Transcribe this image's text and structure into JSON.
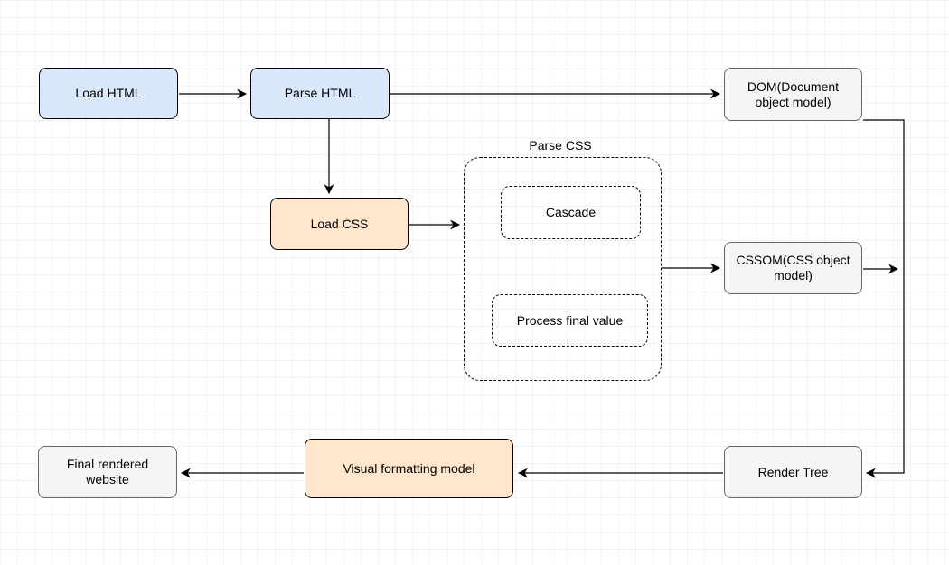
{
  "diagram": {
    "nodes": {
      "load_html": "Load HTML",
      "parse_html": "Parse HTML",
      "dom": "DOM(Document object model)",
      "load_css": "Load CSS",
      "parse_css_group": "Parse CSS",
      "cascade": "Cascade",
      "process_final": "Process final value",
      "cssom": "CSSOM(CSS object model)",
      "render_tree": "Render Tree",
      "visual_formatting": "Visual formatting model",
      "final_rendered": "Final rendered website"
    }
  }
}
